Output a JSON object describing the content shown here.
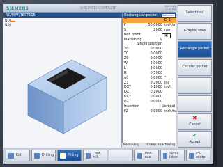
{
  "header": {
    "logo": "SIEMENS",
    "title": "SINUMERIK OPERATE",
    "date": "06/12/13",
    "time": "1:48 PM"
  },
  "path": "NC/MPF/TEST115",
  "left": {
    "line1": "N10",
    "line2": "N20"
  },
  "form": {
    "title": "Rectangular pocket",
    "tag": "Tool select",
    "rows": [
      {
        "label": "T",
        "value": "",
        "unit": "D 1",
        "cls": "sel"
      },
      {
        "label": "F",
        "value": "50.0000",
        "unit": "inch/min"
      },
      {
        "label": "S",
        "value": "2000",
        "unit": "rpm"
      },
      {
        "label": "Ref. point",
        "value": "▣",
        "unit": "",
        "cls": "boxed"
      },
      {
        "label": "Machining",
        "value": "∇",
        "unit": ""
      },
      {
        "label": "Single position",
        "value": "",
        "unit": "",
        "cls": "center"
      },
      {
        "label": "X0",
        "value": "0.0000",
        "unit": ""
      },
      {
        "label": "Y0",
        "value": "0.0000",
        "unit": ""
      },
      {
        "label": "Z0",
        "value": "0.0000",
        "unit": ""
      },
      {
        "label": "W",
        "value": "2.0000",
        "unit": ""
      },
      {
        "label": "L",
        "value": "3.0000",
        "unit": ""
      },
      {
        "label": "R",
        "value": "0.5000",
        "unit": ""
      },
      {
        "label": "α0",
        "value": "0.0000",
        "unit": "°"
      },
      {
        "label": "Z1",
        "value": "0.2000",
        "unit": "inc"
      },
      {
        "label": "DXY",
        "value": "0.1000",
        "unit": "inch"
      },
      {
        "label": "DZ",
        "value": "0.1000",
        "unit": ""
      },
      {
        "label": "UXY",
        "value": "0.0000",
        "unit": ""
      },
      {
        "label": "UZ",
        "value": "0.0000",
        "unit": ""
      },
      {
        "label": "Insertion",
        "value": "Vertical",
        "unit": "",
        "cls": "full"
      },
      {
        "label": "FZ",
        "value": "0.0000",
        "unit": "inch/tooth"
      }
    ]
  },
  "status": {
    "left": "Removing",
    "right": "Comp. machining"
  },
  "softkeys_right": [
    {
      "label": "Select tool",
      "active": false
    },
    {
      "label": "Graphic view",
      "active": false
    },
    {
      "label": "Rectangle pocket",
      "active": true
    },
    {
      "label": "Circular pocket",
      "active": false
    },
    {
      "label": "",
      "active": false
    },
    {
      "label": "",
      "active": false
    },
    {
      "label": "Cancel",
      "active": false
    },
    {
      "label": "Accept",
      "active": false
    }
  ],
  "softkeys_bottom": [
    {
      "label": "Edit",
      "active": false
    },
    {
      "label": "Drilling",
      "active": false
    },
    {
      "label": "Milling",
      "active": true
    },
    {
      "label": "Cont. mill.",
      "active": false
    },
    {
      "label": "",
      "active": false
    },
    {
      "label": "Vari- ous",
      "active": false
    },
    {
      "label": "Simu- lation",
      "active": false
    },
    {
      "label": "Ex- ecute",
      "active": false
    }
  ]
}
